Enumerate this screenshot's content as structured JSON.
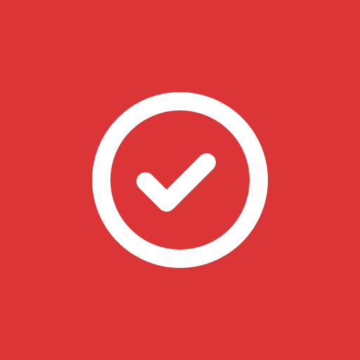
{
  "app_tile": {
    "icon": "check-circle-icon",
    "colors": {
      "background": "#DB3537",
      "foreground": "#FFFFFF"
    }
  }
}
